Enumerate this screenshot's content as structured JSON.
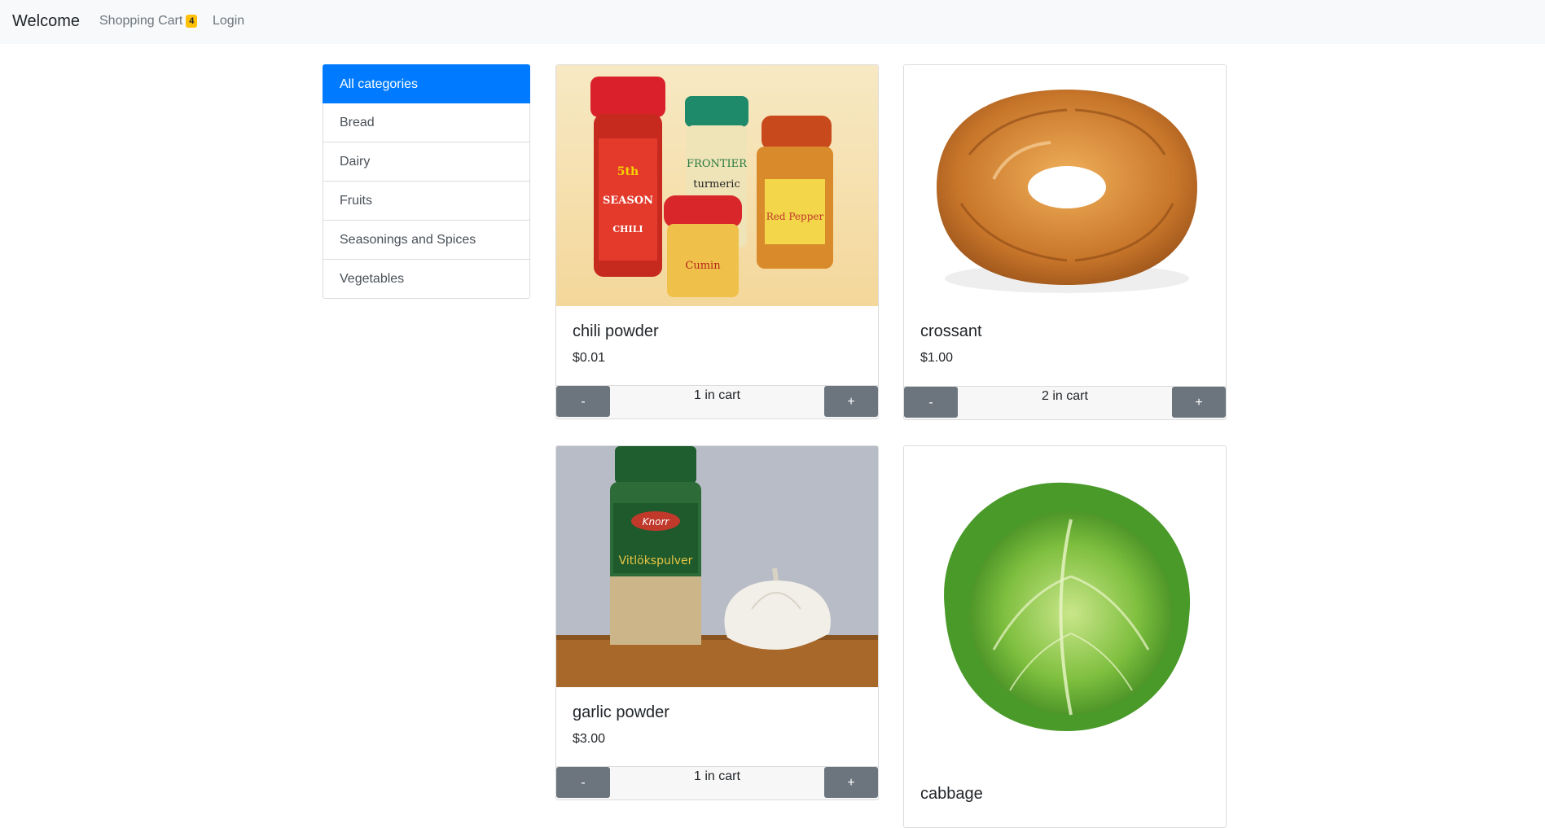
{
  "navbar": {
    "brand": "Welcome",
    "cart_label": "Shopping Cart",
    "cart_count": "4",
    "login_label": "Login"
  },
  "categories": [
    {
      "label": "All categories",
      "active": true
    },
    {
      "label": "Bread"
    },
    {
      "label": "Dairy"
    },
    {
      "label": "Fruits"
    },
    {
      "label": "Seasonings and Spices"
    },
    {
      "label": "Vegetables"
    }
  ],
  "products": [
    {
      "name": "chili powder",
      "price": "$0.01",
      "in_cart": "1 in cart",
      "minus": "-",
      "plus": "+",
      "image": "spice-jars-photo"
    },
    {
      "name": "crossant",
      "price": "$1.00",
      "in_cart": "2 in cart",
      "minus": "-",
      "plus": "+",
      "image": "croissant-photo"
    },
    {
      "name": "garlic powder",
      "price": "$3.00",
      "in_cart": "1 in cart",
      "minus": "-",
      "plus": "+",
      "image": "garlic-powder-photo"
    },
    {
      "name": "cabbage",
      "image": "cabbage-photo"
    }
  ],
  "colors": {
    "primary": "#007bff",
    "secondary_button": "#6c757d",
    "badge": "#ffc107",
    "navbar_bg": "#f8f9fa"
  }
}
